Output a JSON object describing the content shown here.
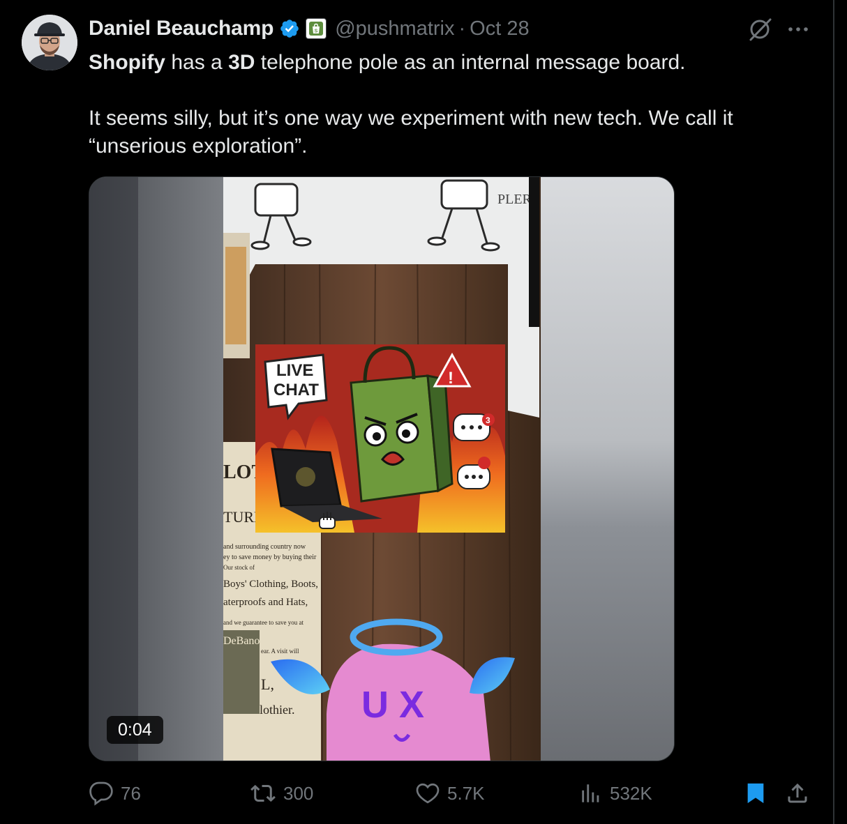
{
  "tweet": {
    "display_name": "Daniel Beauchamp",
    "handle": "@pushmatrix",
    "separator": "·",
    "date": "Oct 28",
    "text": {
      "line1_bold1": "Shopify",
      "line1_mid": " has a ",
      "line1_bold2": "3D",
      "line1_end": " telephone pole as an internal message board.",
      "line2": "It seems silly, but it’s one way we experiment with new tech. We call it",
      "line3": "“unserious exploration”."
    },
    "media": {
      "duration": "0:04",
      "poster_text": {
        "live_chat_1": "LIVE",
        "live_chat_2": "CHAT",
        "badge_count": "3",
        "plex": "PLER",
        "ux": "U X",
        "clothing": "LOTHING",
        "saturday": "TURDAY, MA",
        "body1": "and surrounding country now",
        "body2": "ey to save money by buying their",
        "body3": "Our stock of",
        "body4": "Boys' Clothing, Boots,",
        "body5": "aterproofs and Hats,",
        "body6": "and we guarantee to save you at",
        "debano": "DeBano",
        "body7": "ear. A visit will",
        "body8": "L,",
        "body9": "lothier."
      }
    }
  },
  "actions": {
    "replies": "76",
    "reposts": "300",
    "likes": "5.7K",
    "views": "532K"
  },
  "colors": {
    "background": "#000000",
    "text_primary": "#e7e9ea",
    "text_secondary": "#71767b",
    "verified_blue": "#1d9bf0",
    "shopify_green": "#5e8e3e"
  },
  "icons": {
    "verified": "verified-badge-icon",
    "affiliate": "shopify-affiliate-icon",
    "grok": "grok-icon",
    "more": "more-icon",
    "reply": "reply-icon",
    "repost": "repost-icon",
    "like": "like-icon",
    "views": "views-icon",
    "bookmark": "bookmark-icon",
    "share": "share-icon"
  }
}
